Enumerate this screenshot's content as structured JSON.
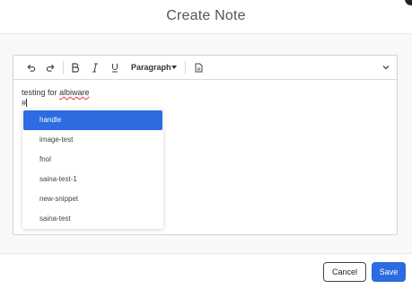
{
  "modal": {
    "title": "Create Note"
  },
  "toolbar": {
    "block_format": "Paragraph",
    "icons": [
      "undo-icon",
      "redo-icon",
      "bold-icon",
      "italic-icon",
      "underline-icon",
      "document-icon",
      "chevron-down-icon"
    ]
  },
  "editor": {
    "line1_prefix": "testing for ",
    "line1_misspelled": "albiware",
    "line2": "#"
  },
  "mention_menu": {
    "items": [
      "handle",
      "image-test",
      "fnol",
      "saina-test-1",
      "new-snippet",
      "saina-test"
    ],
    "selected_index": 0
  },
  "footer": {
    "cancel_label": "Cancel",
    "save_label": "Save"
  },
  "colors": {
    "accent": "#2c6be0",
    "page_background": "#f7f8fa"
  }
}
